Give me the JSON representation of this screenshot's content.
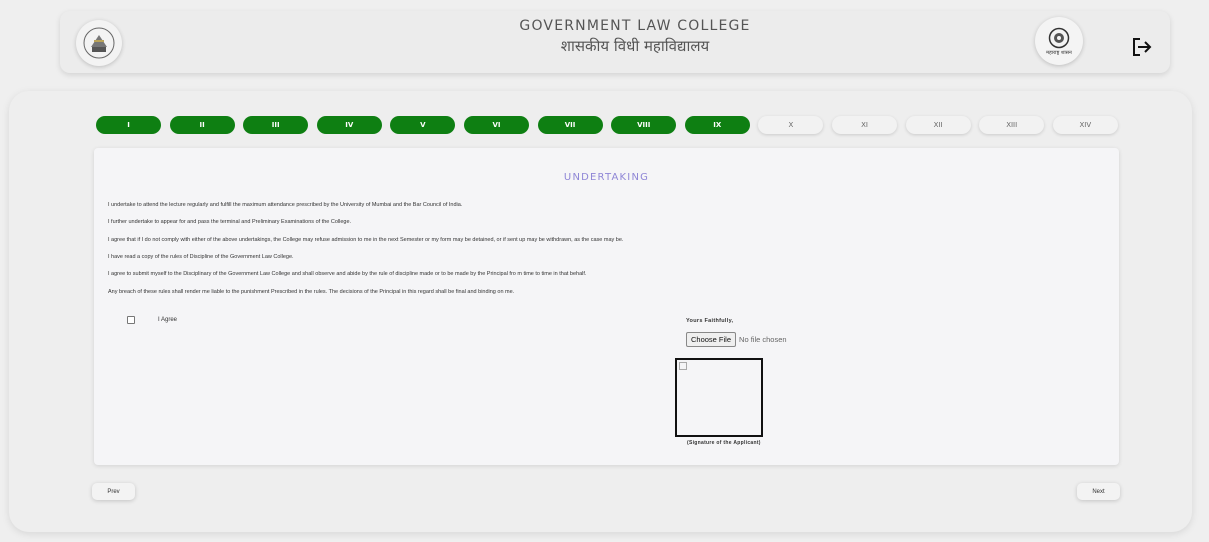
{
  "header": {
    "title_en": "GOVERNMENT LAW COLLEGE",
    "title_hi": "शासकीय विधी महाविद्यालय",
    "right_logo_text": "महाराष्ट्र शासन"
  },
  "steps": [
    {
      "label": "I",
      "done": true
    },
    {
      "label": "II",
      "done": true
    },
    {
      "label": "III",
      "done": true
    },
    {
      "label": "IV",
      "done": true
    },
    {
      "label": "V",
      "done": true
    },
    {
      "label": "VI",
      "done": true
    },
    {
      "label": "VII",
      "done": true
    },
    {
      "label": "VIII",
      "done": true
    },
    {
      "label": "IX",
      "done": true
    },
    {
      "label": "X",
      "done": false
    },
    {
      "label": "XI",
      "done": false
    },
    {
      "label": "XII",
      "done": false
    },
    {
      "label": "XIII",
      "done": false
    },
    {
      "label": "XIV",
      "done": false
    }
  ],
  "undertaking": {
    "title": "UNDERTAKING",
    "paragraphs": [
      "I undertake to attend the lecture regularly and fulfill the maximum attendance prescribed by the University of Mumbai and the Bar Council of India.",
      "I further undertake to appear for and pass the terminal and Preliminary Examinations of the College.",
      "I agree that if I do not comply with either of the above undertakings, the College may refuse admission to me in the next Semester or my form may be detained, or if sent up may be withdrawn, as the case may be.",
      "I have read a copy of the rules of Discipline of the Government Law College.",
      "I agree to submit myself to the Disciplinary of the Government Law College and shall observe and abide by the rule of discipline made or to be made by the Principal fro m time to time in that behalf.",
      "Any breach of these rules shall render me liable to the punishment Prescribed in the rules. The decisions of the Principal in this regard shall be final and binding on me."
    ],
    "agree_label": "I Agree",
    "agree_checked": false,
    "yours_faithfully": "Yours Faithfully,",
    "choose_file_label": "Choose File",
    "file_status": "No file chosen",
    "signature_caption": "(Signature of the Applicant)"
  },
  "nav": {
    "prev_label": "Prev",
    "next_label": "Next"
  },
  "colors": {
    "step_done": "#0e7f12",
    "title_accent": "#8f86d6",
    "background": "#efefef"
  }
}
